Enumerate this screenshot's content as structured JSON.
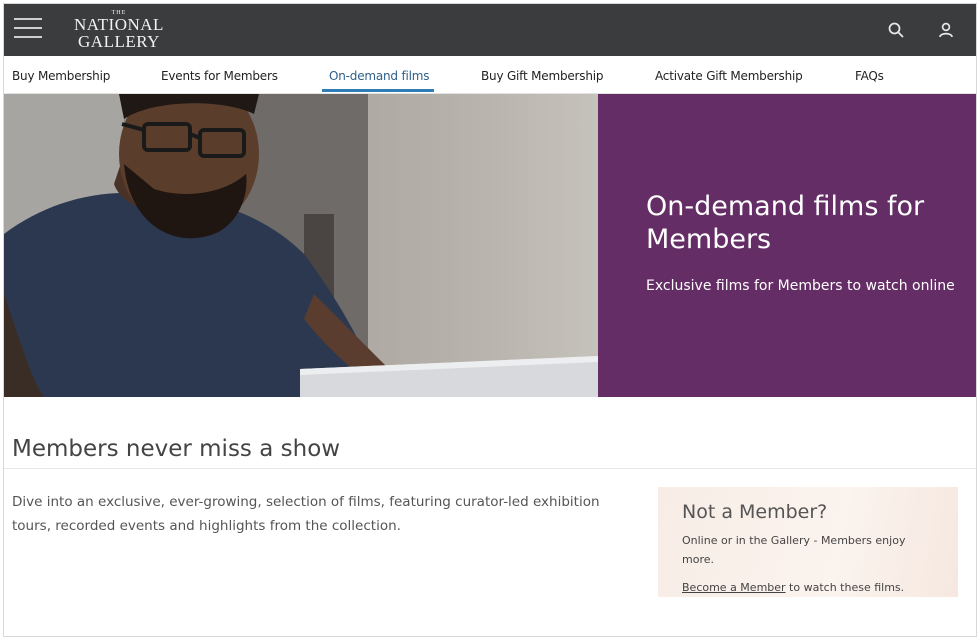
{
  "header": {
    "logo_the": "THE",
    "logo_line1": "NATIONAL",
    "logo_line2": "GALLERY"
  },
  "subnav": {
    "items": [
      {
        "label": "Buy Membership"
      },
      {
        "label": "Events for Members"
      },
      {
        "label": "On-demand films",
        "active": true
      },
      {
        "label": "Buy Gift Membership"
      },
      {
        "label": "Activate Gift Membership"
      },
      {
        "label": "FAQs"
      }
    ]
  },
  "hero": {
    "title": "On-demand films for Members",
    "subtitle": "Exclusive films for Members to watch online"
  },
  "main": {
    "heading": "Members never miss a show",
    "body": "Dive into an exclusive, ever-growing, selection of films, featuring curator-led exhibition tours, recorded events and highlights from the collection."
  },
  "member_card": {
    "title": "Not a Member?",
    "text": "Online or in the Gallery - Members enjoy more.",
    "link_label": "Become a Member",
    "link_suffix": " to watch these films."
  },
  "colors": {
    "topbar": "#3b3c3e",
    "hero_panel": "#652d66",
    "active_nav": "#2e7db5"
  },
  "icons": {
    "menu": "hamburger-menu-icon",
    "search": "search-icon",
    "account": "account-icon"
  }
}
